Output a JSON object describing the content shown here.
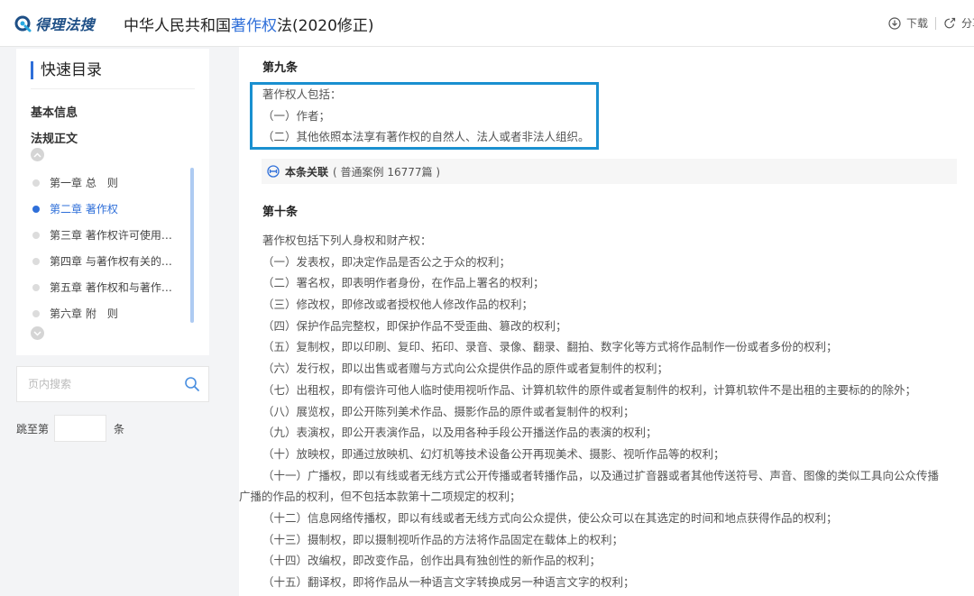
{
  "header": {
    "logo_text": "得理法搜",
    "title_prefix": "中华人民共和国",
    "title_highlight": "著作权",
    "title_suffix": "法(2020修正)",
    "download_label": "下载",
    "share_label": "分享"
  },
  "sidebar": {
    "toc_title": "快速目录",
    "basic_info": "基本信息",
    "law_text": "法规正文",
    "chapters": [
      {
        "label": "第一章 总　则",
        "active": false
      },
      {
        "label": "第二章 著作权",
        "active": true
      },
      {
        "label": "第三章 著作权许可使用和转让合同",
        "active": false
      },
      {
        "label": "第四章 与著作权有关的权利",
        "active": false
      },
      {
        "label": "第五章 著作权和与著作权有关的权利的保护",
        "active": false
      },
      {
        "label": "第六章 附　则",
        "active": false
      }
    ],
    "search_placeholder": "页内搜索",
    "jump_prefix": "跳至第",
    "jump_suffix": "条"
  },
  "article9": {
    "heading": "第九条",
    "lines": [
      "著作权人包括：",
      "（一）作者；",
      "（二）其他依照本法享有著作权的自然人、法人或者非法人组织。"
    ],
    "related_label": "本条关联",
    "related_count": "( 普通案例 16777篇 )"
  },
  "article10": {
    "heading": "第十条",
    "lines": [
      "著作权包括下列人身权和财产权：",
      "（一）发表权，即决定作品是否公之于众的权利；",
      "（二）署名权，即表明作者身份，在作品上署名的权利；",
      "（三）修改权，即修改或者授权他人修改作品的权利；",
      "（四）保护作品完整权，即保护作品不受歪曲、篡改的权利；",
      "（五）复制权，即以印刷、复印、拓印、录音、录像、翻录、翻拍、数字化等方式将作品制作一份或者多份的权利；",
      "（六）发行权，即以出售或者赠与方式向公众提供作品的原件或者复制件的权利；",
      "（七）出租权，即有偿许可他人临时使用视听作品、计算机软件的原件或者复制件的权利，计算机软件不是出租的主要标的的除外；",
      "（八）展览权，即公开陈列美术作品、摄影作品的原件或者复制件的权利；",
      "（九）表演权，即公开表演作品，以及用各种手段公开播送作品的表演的权利；",
      "（十）放映权，即通过放映机、幻灯机等技术设备公开再现美术、摄影、视听作品等的权利；",
      "（十一）广播权，即以有线或者无线方式公开传播或者转播作品，以及通过扩音器或者其他传送符号、声音、图像的类似工具向公众传播",
      "广播的作品的权利，但不包括本款第十二项规定的权利；",
      "（十二）信息网络传播权，即以有线或者无线方式向公众提供，使公众可以在其选定的时间和地点获得作品的权利；",
      "（十三）摄制权，即以摄制视听作品的方法将作品固定在载体上的权利；",
      "（十四）改编权，即改变作品，创作出具有独创性的新作品的权利；",
      "（十五）翻译权，即将作品从一种语言文字转换成另一种语言文字的权利；"
    ]
  },
  "colors": {
    "accent": "#2f6fd9",
    "highlight_border": "#1a90d0",
    "logo": "#1e4f86"
  }
}
